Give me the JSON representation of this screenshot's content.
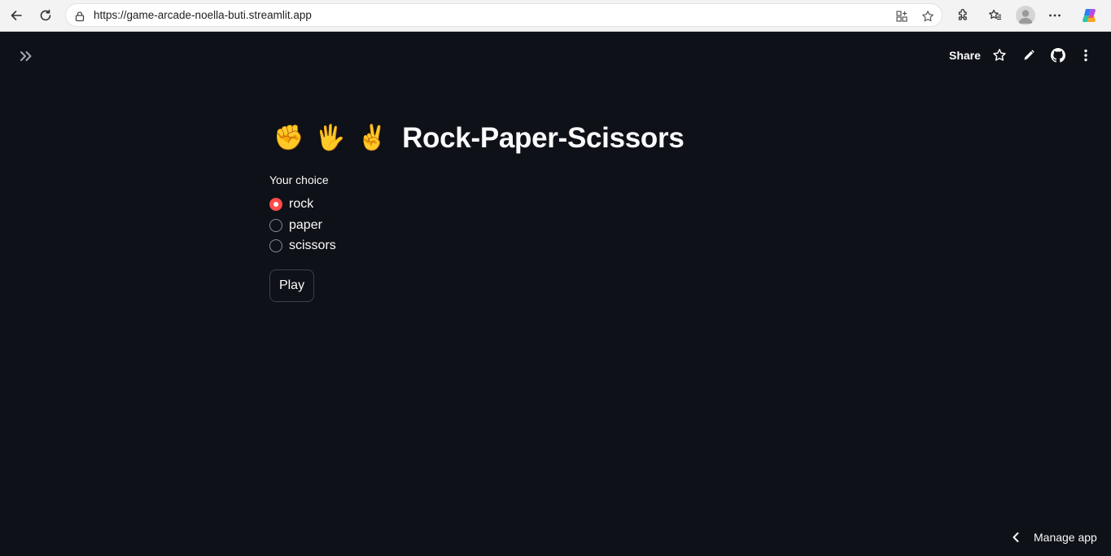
{
  "browser": {
    "url": "https://game-arcade-noella-buti.streamlit.app"
  },
  "header": {
    "share_label": "Share"
  },
  "main": {
    "title_emojis": [
      "✊",
      "🖐",
      "✌"
    ],
    "title": "Rock-Paper-Scissors",
    "choice_label": "Your choice",
    "options": [
      "rock",
      "paper",
      "scissors"
    ],
    "selected_option": "rock",
    "play_label": "Play"
  },
  "footer": {
    "manage_label": "Manage app"
  },
  "colors": {
    "background": "#0e1117",
    "accent": "#ff4b4b",
    "text": "#fafafa"
  }
}
